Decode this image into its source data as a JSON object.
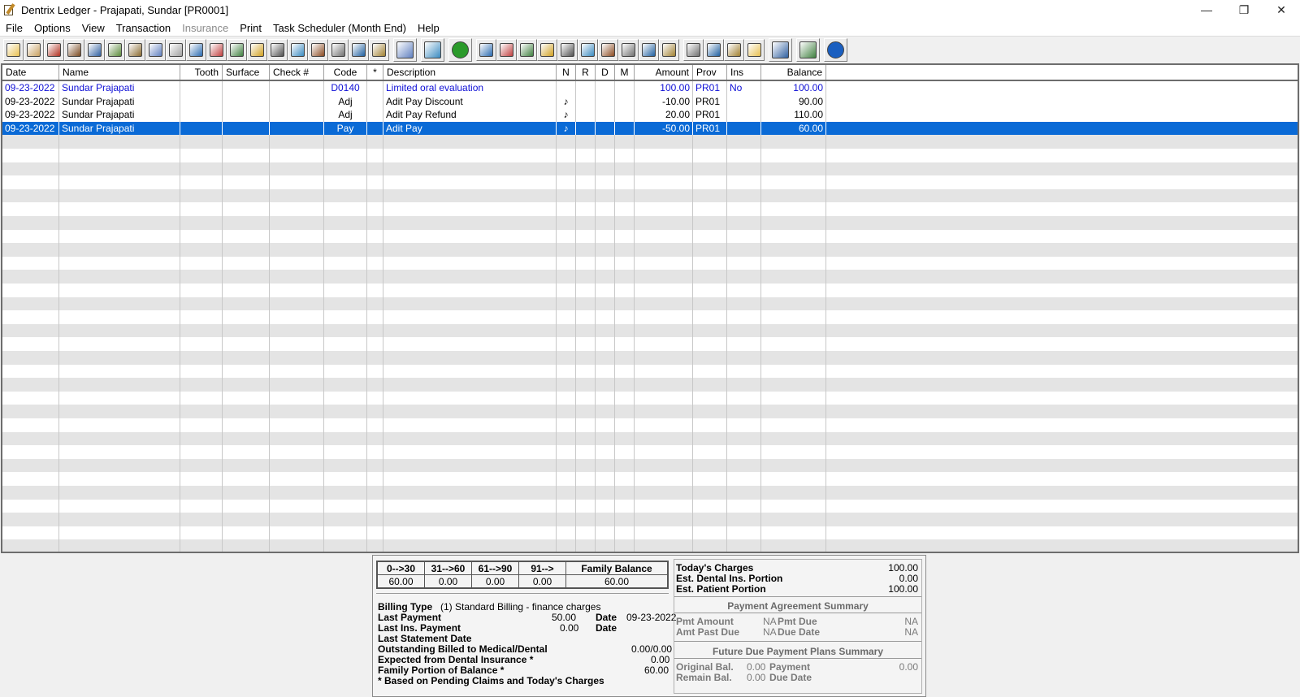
{
  "window": {
    "title": "Dentrix Ledger - Prajapati, Sundar [PR0001]",
    "controls": {
      "minimize": "—",
      "restore": "❐",
      "close": "✕"
    }
  },
  "menu": [
    "File",
    "Options",
    "View",
    "Transaction",
    "Insurance",
    "Print",
    "Task Scheduler (Month End)",
    "Help"
  ],
  "toolbar_icons": [
    [
      "patient-select-icon",
      "family-file-icon",
      "book-icon",
      "provider-icon",
      "id-card-icon",
      "treatment-icon",
      "pen-icon",
      "eraser-icon",
      "note-icon",
      "search-icon",
      "email-icon",
      "grid-icon",
      "cross-icon",
      "rx-icon",
      "edit-icon",
      "book-closed-icon",
      "notes-icon",
      "map-icon",
      "eob-icon"
    ],
    [
      "bank-icon"
    ],
    [
      "person-icon"
    ],
    [
      "refresh-icon"
    ],
    [
      "handshake-icon",
      "dollar-icon",
      "g-icon",
      "transfer-icon",
      "statement-icon",
      "ins-icon",
      "ins-2-icon",
      "tax-icon",
      "calculator-icon",
      "pay-plan-icon"
    ],
    [
      "walker-icon",
      "referral-icon",
      "family-icon",
      "appointment-icon"
    ],
    [
      "patient-icon"
    ],
    [
      "refresh-person-icon"
    ],
    [
      "info-icon"
    ]
  ],
  "columns": {
    "date": "Date",
    "name": "Name",
    "tooth": "Tooth",
    "surface": "Surface",
    "check": "Check #",
    "code": "Code",
    "star": "*",
    "description": "Description",
    "n": "N",
    "r": "R",
    "d": "D",
    "m": "M",
    "amount": "Amount",
    "prov": "Prov",
    "ins": "Ins",
    "balance": "Balance"
  },
  "ledger_rows": [
    {
      "date": "09-23-2022",
      "name": "Sundar  Prajapati",
      "tooth": "",
      "surface": "",
      "check": "",
      "code": "D0140",
      "star": "",
      "description": "Limited oral evaluation",
      "n": "",
      "r": "",
      "d": "",
      "m": "",
      "amount": "100.00",
      "prov": "PR01",
      "ins": "No",
      "balance": "100.00",
      "style": "blue"
    },
    {
      "date": "09-23-2022",
      "name": "Sundar  Prajapati",
      "tooth": "",
      "surface": "",
      "check": "",
      "code": "Adj",
      "star": "",
      "description": "Adit Pay Discount",
      "n": "♪",
      "r": "",
      "d": "",
      "m": "",
      "amount": "-10.00",
      "prov": "PR01",
      "ins": "",
      "balance": "90.00",
      "style": "data"
    },
    {
      "date": "09-23-2022",
      "name": "Sundar  Prajapati",
      "tooth": "",
      "surface": "",
      "check": "",
      "code": "Adj",
      "star": "",
      "description": "Adit Pay Refund",
      "n": "♪",
      "r": "",
      "d": "",
      "m": "",
      "amount": "20.00",
      "prov": "PR01",
      "ins": "",
      "balance": "110.00",
      "style": "data"
    },
    {
      "date": "09-23-2022",
      "name": "Sundar  Prajapati",
      "tooth": "",
      "surface": "",
      "check": "",
      "code": "Pay",
      "star": "",
      "description": "Adit Pay",
      "n": "♪",
      "r": "",
      "d": "",
      "m": "",
      "amount": "-50.00",
      "prov": "PR01",
      "ins": "",
      "balance": "60.00",
      "style": "selected"
    }
  ],
  "aging": {
    "headers": [
      "0-->30",
      "31-->60",
      "61-->90",
      "91-->",
      "Family Balance"
    ],
    "values": [
      "60.00",
      "0.00",
      "0.00",
      "0.00",
      "60.00"
    ]
  },
  "account": {
    "billing_type_label": "Billing Type",
    "billing_type_value": "(1) Standard Billing - finance charges",
    "last_payment_label": "Last Payment",
    "last_payment_value": "50.00",
    "last_payment_date_label": "Date",
    "last_payment_date_value": "09-23-2022",
    "last_ins_payment_label": "Last Ins. Payment",
    "last_ins_payment_value": "0.00",
    "last_ins_payment_date_label": "Date",
    "last_statement_label": "Last Statement Date",
    "outstanding_label": "Outstanding Billed to Medical/Dental",
    "outstanding_value": "0.00/0.00",
    "expected_label": "Expected from Dental Insurance *",
    "expected_value": "0.00",
    "family_portion_label": "Family Portion of Balance *",
    "family_portion_value": "60.00",
    "footnote": "* Based on Pending Claims and Today's Charges"
  },
  "today": {
    "charges_label": "Today's Charges",
    "charges_value": "100.00",
    "ins_label": "Est. Dental Ins. Portion",
    "ins_value": "0.00",
    "patient_label": "Est. Patient Portion",
    "patient_value": "100.00"
  },
  "payment_agreement": {
    "title": "Payment Agreement Summary",
    "pmt_amount_label": "Pmt Amount",
    "pmt_amount_value": "NA",
    "pmt_due_label": "Pmt Due",
    "pmt_due_value": "NA",
    "amt_past_due_label": "Amt Past Due",
    "amt_past_due_value": "NA",
    "due_date_label": "Due Date",
    "due_date_value": "NA"
  },
  "future_due": {
    "title": "Future Due Payment Plans Summary",
    "original_bal_label": "Original Bal.",
    "original_bal_value": "0.00",
    "payment_label": "Payment",
    "payment_value": "0.00",
    "remain_bal_label": "Remain Bal.",
    "remain_bal_value": "0.00",
    "due_date_label": "Due Date"
  }
}
